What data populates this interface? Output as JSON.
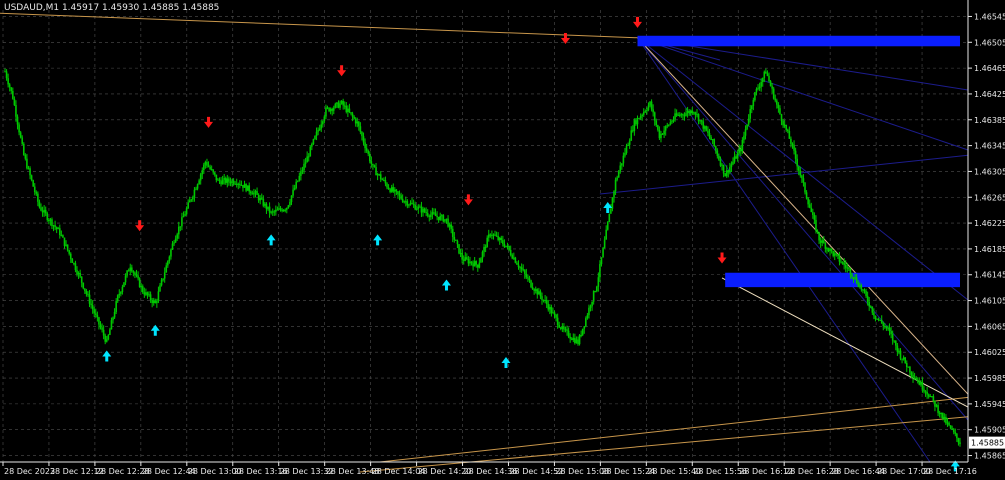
{
  "chart_title": "USDAUD,M1  1.45917 1.45930 1.45885 1.45885",
  "colors": {
    "background": "#000000",
    "grid": "#505050",
    "candle": "#00c800",
    "signal_up": "#00e5ff",
    "signal_down": "#ff1a1a",
    "trendline": "#c8964b",
    "fib_lines": "#1c1c8c",
    "zone": "#0a1eff",
    "text": "#e8e8e8",
    "price_tag_bg": "#ffffff",
    "price_tag_fg": "#000000"
  },
  "chart_data": {
    "type": "candlestick",
    "symbol": "USDAUD",
    "timeframe": "M1",
    "ohlc_readout": {
      "open": 1.45917,
      "high": 1.4593,
      "low": 1.45885,
      "close": 1.45885
    },
    "current_price": "1.45885",
    "y_ticks": [
      "1.46545",
      "1.46505",
      "1.46465",
      "1.46425",
      "1.46385",
      "1.46345",
      "1.46305",
      "1.46265",
      "1.46225",
      "1.46185",
      "1.46145",
      "1.46105",
      "1.46065",
      "1.46025",
      "1.45985",
      "1.45945",
      "1.45905",
      "1.45865"
    ],
    "ylim": [
      1.45855,
      1.46555
    ],
    "x_ticks": [
      "28 Dec 2023",
      "28 Dec 12:12",
      "28 Dec 12:28",
      "28 Dec 12:44",
      "28 Dec 13:00",
      "28 Dec 13:16",
      "28 Dec 13:32",
      "28 Dec 13:48",
      "28 Dec 14:04",
      "28 Dec 14:20",
      "28 Dec 14:36",
      "28 Dec 14:52",
      "28 Dec 15:08",
      "28 Dec 15:24",
      "28 Dec 15:40",
      "28 Dec 15:56",
      "28 Dec 16:12",
      "28 Dec 16:28",
      "28 Dec 16:44",
      "28 Dec 17:00",
      "28 Dec 17:16"
    ],
    "grid": true,
    "bars": 320,
    "price_path": [
      [
        0,
        1.4646
      ],
      [
        5,
        1.4642
      ],
      [
        12,
        1.4633
      ],
      [
        22,
        1.4625
      ],
      [
        35,
        1.4621
      ],
      [
        48,
        1.4614
      ],
      [
        58,
        1.4608
      ],
      [
        65,
        1.4604
      ],
      [
        72,
        1.4611
      ],
      [
        80,
        1.4616
      ],
      [
        88,
        1.4612
      ],
      [
        96,
        1.461
      ],
      [
        108,
        1.462
      ],
      [
        120,
        1.4627
      ],
      [
        128,
        1.4632
      ],
      [
        136,
        1.4629
      ],
      [
        148,
        1.4629
      ],
      [
        160,
        1.4627
      ],
      [
        170,
        1.4624
      ],
      [
        180,
        1.4625
      ],
      [
        192,
        1.4632
      ],
      [
        205,
        1.464
      ],
      [
        215,
        1.4641
      ],
      [
        225,
        1.4638
      ],
      [
        235,
        1.4631
      ],
      [
        245,
        1.4628
      ],
      [
        255,
        1.4626
      ],
      [
        270,
        1.4624
      ],
      [
        282,
        1.4623
      ],
      [
        292,
        1.4617
      ],
      [
        302,
        1.4616
      ],
      [
        310,
        1.4621
      ],
      [
        320,
        1.4619
      ],
      [
        336,
        1.4613
      ],
      [
        346,
        1.461
      ],
      [
        356,
        1.4606
      ],
      [
        366,
        1.4604
      ],
      [
        378,
        1.4613
      ],
      [
        390,
        1.4629
      ],
      [
        402,
        1.4638
      ],
      [
        412,
        1.4641
      ],
      [
        418,
        1.4636
      ],
      [
        428,
        1.4639
      ],
      [
        440,
        1.464
      ],
      [
        452,
        1.4635
      ],
      [
        460,
        1.463
      ],
      [
        470,
        1.4634
      ],
      [
        478,
        1.4642
      ],
      [
        486,
        1.4646
      ],
      [
        494,
        1.464
      ],
      [
        502,
        1.4635
      ],
      [
        508,
        1.463
      ],
      [
        514,
        1.4625
      ],
      [
        520,
        1.462
      ],
      [
        528,
        1.4618
      ],
      [
        540,
        1.4615
      ],
      [
        548,
        1.4612
      ],
      [
        556,
        1.4608
      ],
      [
        564,
        1.4606
      ],
      [
        572,
        1.4602
      ],
      [
        580,
        1.4599
      ],
      [
        590,
        1.4596
      ],
      [
        600,
        1.4592
      ],
      [
        610,
        1.45885
      ]
    ],
    "signals_up": [
      {
        "i": 65,
        "price": 1.4604
      },
      {
        "i": 96,
        "price": 1.4608
      },
      {
        "i": 170,
        "price": 1.4622
      },
      {
        "i": 238,
        "price": 1.4622
      },
      {
        "i": 282,
        "price": 1.4615
      },
      {
        "i": 320,
        "price": 1.4603
      },
      {
        "i": 385,
        "price": 1.4627
      },
      {
        "i": 607,
        "price": 1.4587
      }
    ],
    "signals_down": [
      {
        "i": 86,
        "price": 1.462
      },
      {
        "i": 130,
        "price": 1.4636
      },
      {
        "i": 215,
        "price": 1.4644
      },
      {
        "i": 296,
        "price": 1.4624
      },
      {
        "i": 358,
        "price": 1.4649
      },
      {
        "i": 404,
        "price": 1.46515
      },
      {
        "i": 458,
        "price": 1.4615
      }
    ],
    "zones": [
      {
        "from_price": 1.46512,
        "to_price": 1.46505,
        "start_i": 404
      },
      {
        "from_price": 1.46145,
        "to_price": 1.46132,
        "start_i": 460
      }
    ]
  }
}
